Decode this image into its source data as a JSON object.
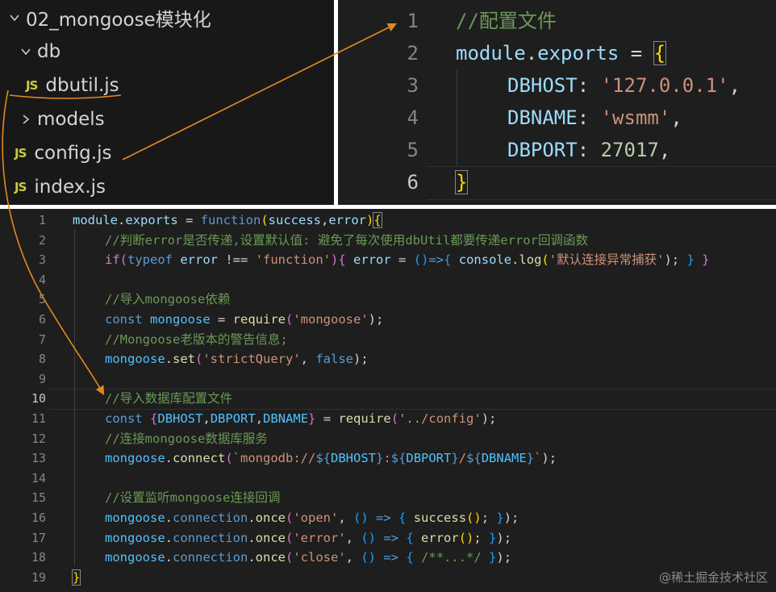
{
  "explorer": {
    "items": [
      {
        "label": "02_mongoose模块化",
        "kind": "folder-open"
      },
      {
        "label": "db",
        "kind": "folder-open"
      },
      {
        "label": "dbutil.js",
        "kind": "file",
        "badge": "JS"
      },
      {
        "label": "models",
        "kind": "folder-closed"
      },
      {
        "label": "config.js",
        "kind": "file",
        "badge": "JS"
      },
      {
        "label": "index.js",
        "kind": "file",
        "badge": "JS"
      }
    ]
  },
  "config_editor": {
    "line_numbers": [
      "1",
      "2",
      "3",
      "4",
      "5",
      "6"
    ],
    "active_line": "6",
    "lines": [
      "//配置文件",
      "module.exports = {",
      "    DBHOST: '127.0.0.1',",
      "    DBNAME: 'wsmm',",
      "    DBPORT: 27017,",
      "}"
    ]
  },
  "main_editor": {
    "line_numbers": [
      "1",
      "2",
      "3",
      "4",
      "5",
      "6",
      "7",
      "8",
      "9",
      "10",
      "11",
      "12",
      "13",
      "14",
      "15",
      "16",
      "17",
      "18",
      "19"
    ],
    "active_line": "10",
    "tokens": {
      "l1": [
        "module",
        ".",
        "exports",
        " = ",
        "function",
        "(",
        "success",
        ",",
        "error",
        ")",
        "{"
      ],
      "l2": "//判断error是否传递,设置默认值: 避免了每次使用dbUtil都要传递error回调函数",
      "l3": [
        "if",
        "(",
        "typeof",
        " error ",
        "!==",
        " ",
        "'function'",
        ")",
        "{",
        " error ",
        "=",
        " ",
        "(",
        ")",
        "=>",
        "{",
        " console",
        ".",
        "log",
        "(",
        "'默认连接异常捕获'",
        ");",
        " ",
        "}",
        " ",
        "}"
      ],
      "l5": "//导入mongoose依赖",
      "l6": [
        "const",
        " ",
        "mongoose",
        " = ",
        "require",
        "(",
        "'mongoose'",
        ");"
      ],
      "l7": "//Mongoose老版本的警告信息;",
      "l8": [
        "mongoose",
        ".",
        "set",
        "(",
        "'strictQuery'",
        ", ",
        "false",
        ");"
      ],
      "l10": "//导入数据库配置文件",
      "l11": [
        "const",
        " ",
        "{",
        "DBHOST",
        ",",
        "DBPORT",
        ",",
        "DBNAME",
        "}",
        " = ",
        "require",
        "(",
        "'../config'",
        ");"
      ],
      "l12": "//连接mongoose数据库服务",
      "l13": [
        "mongoose",
        ".",
        "connect",
        "(",
        "`mongodb://",
        "${",
        "DBHOST",
        "}",
        ":",
        "${",
        "DBPORT",
        "}",
        "/",
        "${",
        "DBNAME",
        "}",
        "`",
        ");"
      ],
      "l15": "//设置监听mongoose连接回调",
      "l16": [
        "mongoose",
        ".",
        "connection",
        ".",
        "once",
        "(",
        "'open'",
        ", ",
        "()",
        " => ",
        "{",
        " ",
        "success",
        "()",
        "; ",
        "}",
        ");"
      ],
      "l17": [
        "mongoose",
        ".",
        "connection",
        ".",
        "once",
        "(",
        "'error'",
        ", ",
        "()",
        " => ",
        "{",
        " ",
        "error",
        "()",
        "; ",
        "}",
        ");"
      ],
      "l18": [
        "mongoose",
        ".",
        "connection",
        ".",
        "once",
        "(",
        "'close'",
        ", ",
        "()",
        " => ",
        "{",
        " ",
        "/**...*/",
        " ",
        "}",
        ");"
      ],
      "l19": "}"
    }
  },
  "watermark": "@稀土掘金技术社区",
  "colors": {
    "editor_bg": "#1e1e1e",
    "explorer_bg": "#181818",
    "keyword": "#569cd6",
    "function": "#dcdcaa",
    "variable": "#9cdcfe",
    "string": "#ce9178",
    "comment": "#6a9955",
    "number": "#b5cea8",
    "arrow": "#e08a1e"
  }
}
